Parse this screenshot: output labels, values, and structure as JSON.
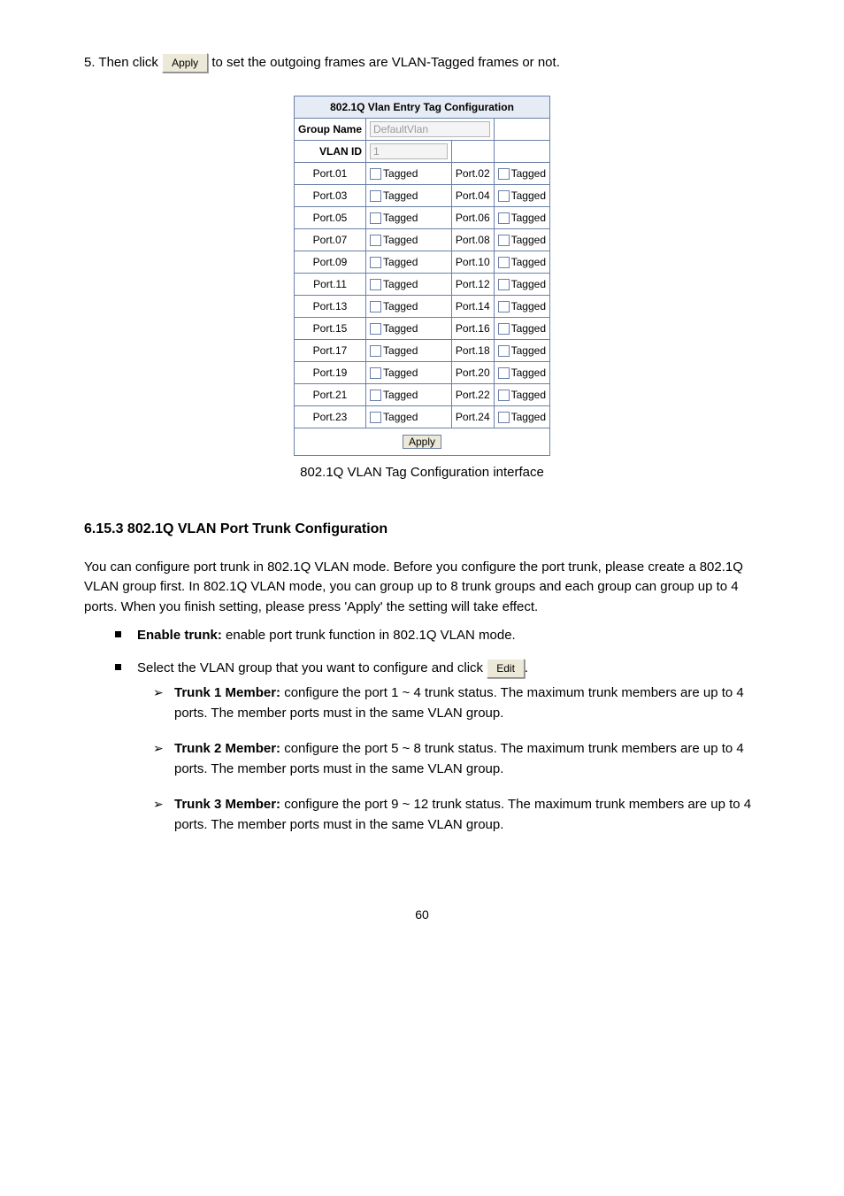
{
  "top": {
    "line_before": "5. Then click",
    "top_btn": "Apply",
    "line_after": "to set the outgoing frames are VLAN-Tagged frames or not."
  },
  "table": {
    "title": "802.1Q Vlan Entry Tag Configuration",
    "group_name_label": "Group Name",
    "group_name_value": "DefaultVlan",
    "vlan_id_label": "VLAN ID",
    "vlan_id_value": "1",
    "tag_word": "Tagged",
    "rows": [
      {
        "l": "Port.01",
        "r": "Port.02"
      },
      {
        "l": "Port.03",
        "r": "Port.04"
      },
      {
        "l": "Port.05",
        "r": "Port.06"
      },
      {
        "l": "Port.07",
        "r": "Port.08"
      },
      {
        "l": "Port.09",
        "r": "Port.10"
      },
      {
        "l": "Port.11",
        "r": "Port.12"
      },
      {
        "l": "Port.13",
        "r": "Port.14"
      },
      {
        "l": "Port.15",
        "r": "Port.16"
      },
      {
        "l": "Port.17",
        "r": "Port.18"
      },
      {
        "l": "Port.19",
        "r": "Port.20"
      },
      {
        "l": "Port.21",
        "r": "Port.22"
      },
      {
        "l": "Port.23",
        "r": "Port.24"
      }
    ],
    "apply": "Apply"
  },
  "caption": "802.1Q VLAN Tag Configuration interface",
  "sec": {
    "heading": "6.15.3 802.1Q VLAN Port Trunk Configuration",
    "intro": "You can configure port trunk in 802.1Q VLAN mode. Before you configure the port trunk, please create a 802.1Q VLAN group first. In 802.1Q VLAN mode, you can group up to 8 trunk groups and each group can group up to 4 ports. When you finish setting, please press 'Apply' the setting will take effect.",
    "b1_bold": "Enable trunk: ",
    "b1_text": "enable port trunk function in 802.1Q VLAN mode.",
    "b2_before": "Select the VLAN group that you want to configure and click ",
    "b2_btn": "Edit",
    "b2_after": ".",
    "a1_bold": "Trunk 1 Member: ",
    "a1_text": "configure the port 1 ~ 4 trunk status. The maximum trunk members are up to 4 ports. The member ports must in the same VLAN group.",
    "a2_bold": "Trunk 2 Member: ",
    "a2_text": "configure the port 5 ~ 8 trunk status. The maximum trunk members are up to 4 ports. The member ports must in the same VLAN group.",
    "a3_bold": "Trunk 3 Member: ",
    "a3_text": "configure the port 9 ~ 12 trunk status. The maximum trunk members are up to 4 ports. The member ports must in the same VLAN group."
  },
  "footer": "60"
}
